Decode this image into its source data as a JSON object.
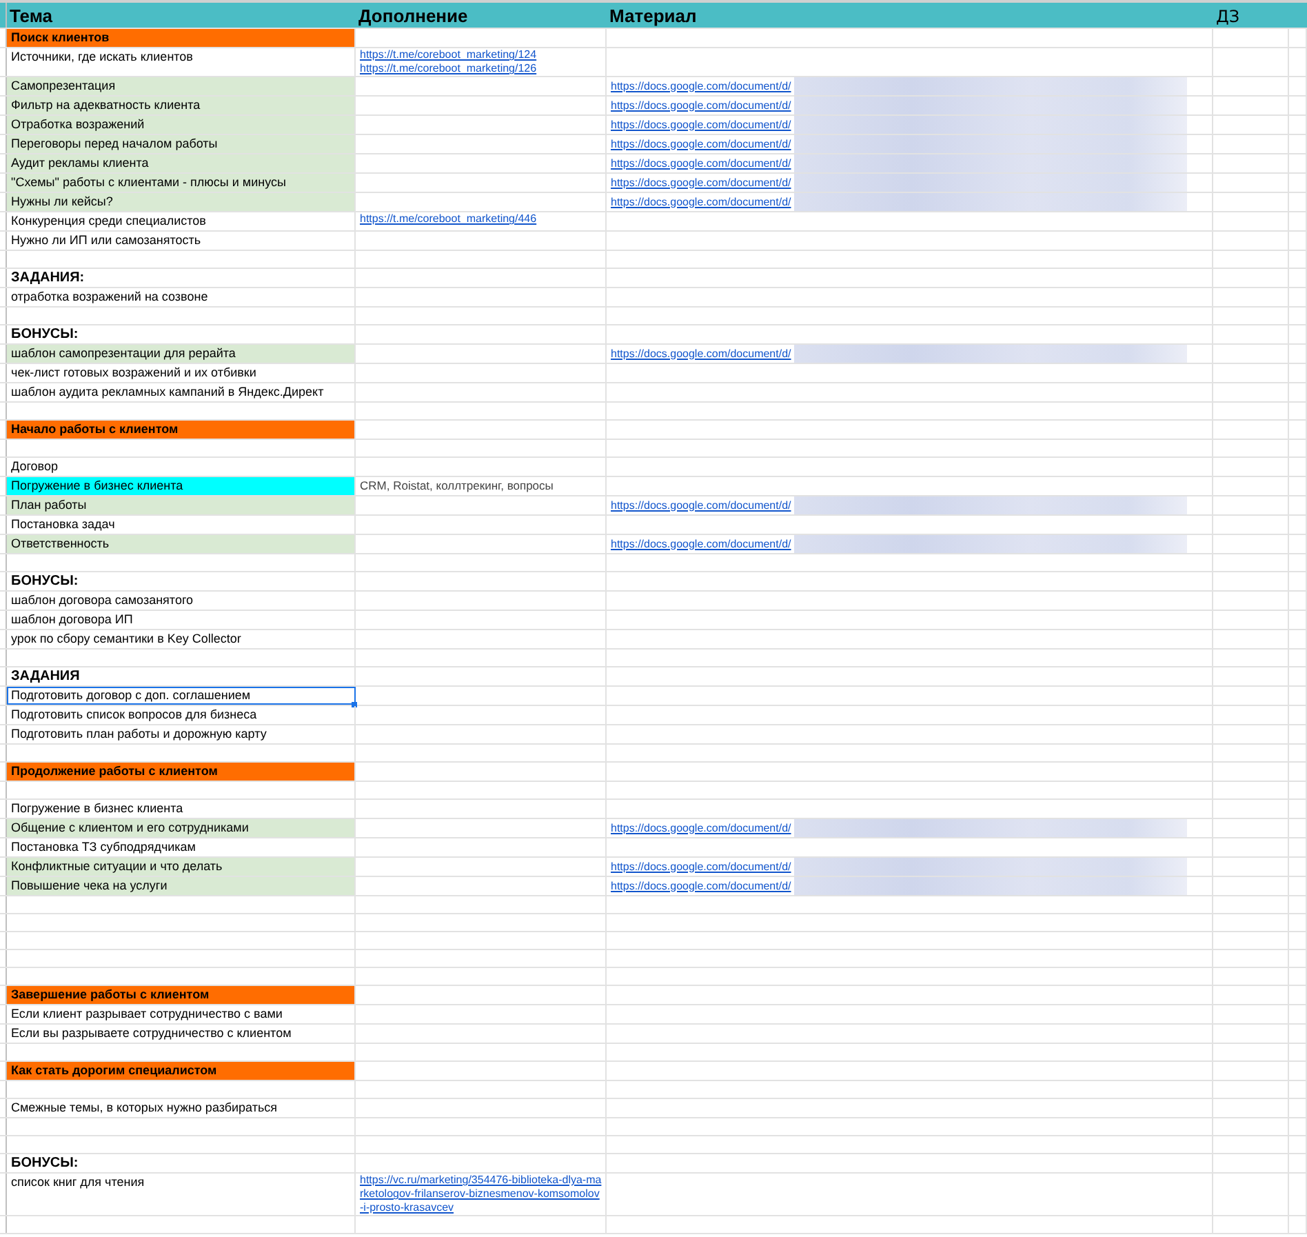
{
  "columns": [
    "Тема",
    "Дополнение",
    "Материал",
    "ДЗ"
  ],
  "rows": [
    {
      "kind": "section",
      "topic": "Поиск клиентов",
      "color": "#ff6d01",
      "selected": false
    },
    {
      "kind": "item",
      "topic": "Источники, где искать клиентов",
      "extra_links": [
        "https://t.me/coreboot_marketing/124",
        "https://t.me/coreboot_marketing/126"
      ],
      "selected": false
    },
    {
      "kind": "item",
      "topic": "Самопрезентация",
      "color": "#d9ead3",
      "material": "https://docs.google.com/document/d/",
      "redacted": true,
      "selected": false
    },
    {
      "kind": "item",
      "topic": "Фильтр на адекватность клиента",
      "color": "#d9ead3",
      "material": "https://docs.google.com/document/d/",
      "redacted": true,
      "selected": false
    },
    {
      "kind": "item",
      "topic": "Отработка возражений",
      "color": "#d9ead3",
      "material": "https://docs.google.com/document/d/",
      "redacted": true,
      "selected": false
    },
    {
      "kind": "item",
      "topic": "Переговоры перед началом работы",
      "color": "#d9ead3",
      "material": "https://docs.google.com/document/d/",
      "redacted": true,
      "selected": false
    },
    {
      "kind": "item",
      "topic": "Аудит рекламы клиента",
      "color": "#d9ead3",
      "material": "https://docs.google.com/document/d/",
      "redacted": true,
      "selected": false
    },
    {
      "kind": "item",
      "topic": "\"Схемы\" работы с клиентами - плюсы и минусы",
      "color": "#d9ead3",
      "material": "https://docs.google.com/document/d/",
      "redacted": true,
      "selected": false
    },
    {
      "kind": "item",
      "topic": "Нужны ли кейсы?",
      "color": "#d9ead3",
      "material": "https://docs.google.com/document/d/",
      "redacted": true,
      "selected": false
    },
    {
      "kind": "item",
      "topic": "Конкуренция среди специалистов",
      "extra_links": [
        "https://t.me/coreboot_marketing/446"
      ],
      "selected": false
    },
    {
      "kind": "item",
      "topic": "Нужно ли ИП или самозанятость",
      "selected": false
    },
    {
      "kind": "empty",
      "selected": false
    },
    {
      "kind": "heading",
      "topic": "ЗАДАНИЯ:",
      "selected": false
    },
    {
      "kind": "item",
      "topic": "отработка возражений на созвоне",
      "selected": false
    },
    {
      "kind": "empty",
      "selected": false
    },
    {
      "kind": "heading",
      "topic": "БОНУСЫ:",
      "selected": false
    },
    {
      "kind": "item",
      "topic": "шаблон самопрезентации для рерайта",
      "color": "#d9ead3",
      "material": "https://docs.google.com/document/d/",
      "redacted": true,
      "selected": false
    },
    {
      "kind": "item",
      "topic": "чек-лист готовых возражений и их отбивки",
      "selected": false
    },
    {
      "kind": "item",
      "topic": "шаблон аудита рекламных кампаний в Яндекс.Директ",
      "selected": false
    },
    {
      "kind": "empty",
      "selected": false
    },
    {
      "kind": "section",
      "topic": "Начало работы с клиентом",
      "color": "#ff6d01",
      "selected": false
    },
    {
      "kind": "empty",
      "selected": false
    },
    {
      "kind": "item",
      "topic": "Договор",
      "selected": false
    },
    {
      "kind": "item",
      "topic": "Погружение в бизнес клиента",
      "color": "#00ffff",
      "extra": "CRM, Roistat, коллтрекинг, вопросы",
      "selected": false
    },
    {
      "kind": "item",
      "topic": "План работы",
      "color": "#d9ead3",
      "material": "https://docs.google.com/document/d/",
      "redacted": true,
      "selected": false
    },
    {
      "kind": "item",
      "topic": "Постановка задач",
      "selected": false
    },
    {
      "kind": "item",
      "topic": "Ответственность",
      "color": "#d9ead3",
      "material": "https://docs.google.com/document/d/",
      "redacted": true,
      "selected": false
    },
    {
      "kind": "empty",
      "selected": false
    },
    {
      "kind": "heading",
      "topic": "БОНУСЫ:",
      "selected": false
    },
    {
      "kind": "item",
      "topic": "шаблон договора самозанятого",
      "selected": false
    },
    {
      "kind": "item",
      "topic": "шаблон договора ИП",
      "selected": false
    },
    {
      "kind": "item",
      "topic": "урок по сбору семантики в Key Collector",
      "selected": false
    },
    {
      "kind": "empty",
      "selected": false
    },
    {
      "kind": "heading",
      "topic": "ЗАДАНИЯ",
      "selected": false
    },
    {
      "kind": "item",
      "topic": "Подготовить договор с доп. соглашением",
      "selected": true
    },
    {
      "kind": "item",
      "topic": "Подготовить список вопросов для бизнеса",
      "selected": false
    },
    {
      "kind": "item",
      "topic": "Подготовить план работы и дорожную карту",
      "selected": false
    },
    {
      "kind": "empty",
      "selected": false
    },
    {
      "kind": "section",
      "topic": "Продолжение работы с клиентом",
      "color": "#ff6d01",
      "selected": false
    },
    {
      "kind": "empty",
      "selected": false
    },
    {
      "kind": "item",
      "topic": "Погружение в бизнес клиента",
      "selected": false
    },
    {
      "kind": "item",
      "topic": "Общение с клиентом и его сотрудниками",
      "color": "#d9ead3",
      "material": "https://docs.google.com/document/d/",
      "redacted": true,
      "selected": false
    },
    {
      "kind": "item",
      "topic": "Постановка ТЗ субподрядчикам",
      "selected": false
    },
    {
      "kind": "item",
      "topic": "Конфликтные ситуации и что делать",
      "color": "#d9ead3",
      "material": "https://docs.google.com/document/d/",
      "redacted": true,
      "selected": false
    },
    {
      "kind": "item",
      "topic": "Повышение чека на услуги",
      "color": "#d9ead3",
      "material": "https://docs.google.com/document/d/",
      "redacted": true,
      "selected": false
    },
    {
      "kind": "empty",
      "selected": false
    },
    {
      "kind": "empty",
      "selected": false
    },
    {
      "kind": "empty",
      "selected": false
    },
    {
      "kind": "empty",
      "selected": false
    },
    {
      "kind": "empty",
      "selected": false
    },
    {
      "kind": "section",
      "topic": "Завершение работы с клиентом",
      "color": "#ff6d01",
      "selected": false
    },
    {
      "kind": "item",
      "topic": "Если клиент разрывает сотрудничество с вами",
      "selected": false
    },
    {
      "kind": "item",
      "topic": "Если вы разрываете сотрудничество с клиентом",
      "selected": false
    },
    {
      "kind": "empty",
      "selected": false
    },
    {
      "kind": "section",
      "topic": "Как стать дорогим специалистом",
      "color": "#ff6d01",
      "selected": false
    },
    {
      "kind": "empty",
      "selected": false
    },
    {
      "kind": "item",
      "topic": "Смежные темы, в которых нужно разбираться",
      "selected": false
    },
    {
      "kind": "empty",
      "selected": false
    },
    {
      "kind": "empty",
      "selected": false
    },
    {
      "kind": "heading",
      "topic": "БОНУСЫ:",
      "selected": false
    },
    {
      "kind": "item",
      "topic": "список книг для чтения",
      "extra_links": [
        "https://vc.ru/marketing/354476-biblioteka-dlya-marketologov-frilanserov-biznesmenov-komsomolov-i-prosto-krasavcev"
      ],
      "selected": false
    },
    {
      "kind": "empty",
      "selected": false
    }
  ]
}
